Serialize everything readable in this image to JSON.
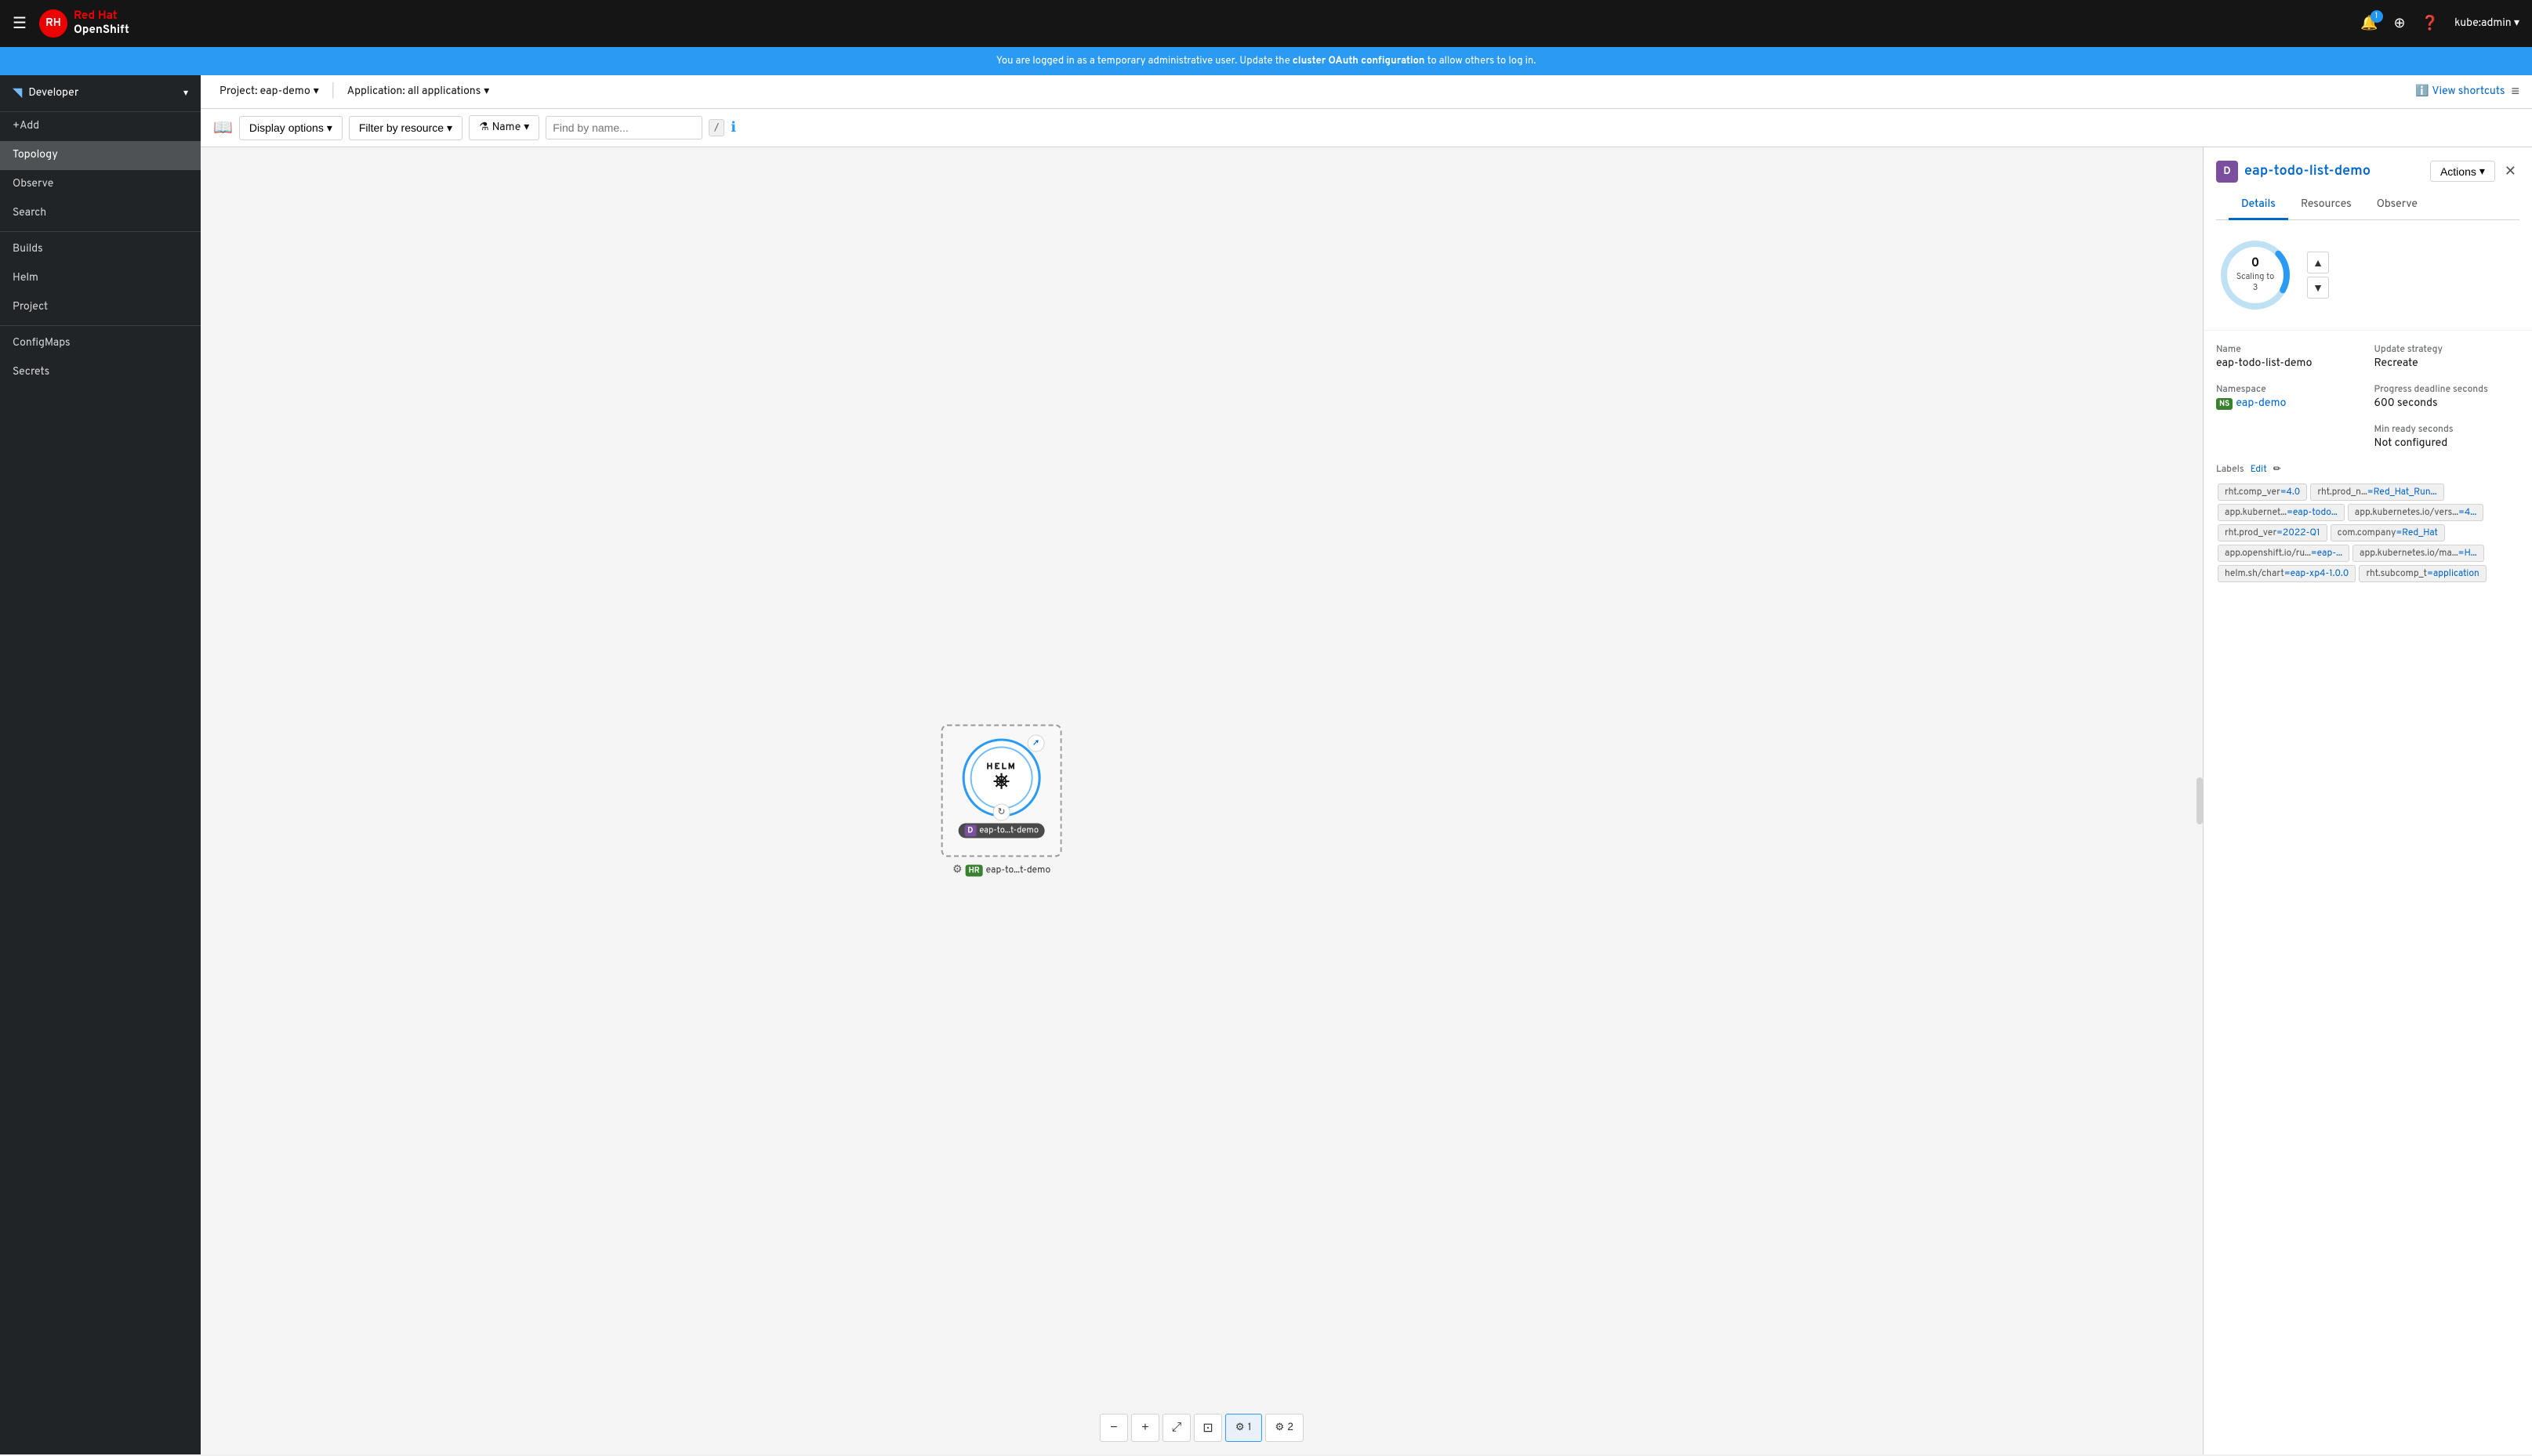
{
  "topnav": {
    "hamburger": "☰",
    "brand_red": "Red Hat",
    "brand_os": "OpenShift",
    "bell_icon": "🔔",
    "bell_count": "1",
    "plus_icon": "+",
    "help_icon": "?",
    "user": "kube:admin ▾"
  },
  "banner": {
    "text": "You are logged in as a temporary administrative user. Update the ",
    "link_text": "cluster OAuth configuration",
    "text2": " to allow others to log in."
  },
  "toolbar": {
    "project_label": "Project: eap-demo",
    "app_label": "Application: all applications",
    "view_shortcuts": "View shortcuts",
    "list_icon": "≡"
  },
  "filter_bar": {
    "display_options": "Display options",
    "filter_by_resource": "Filter by resource",
    "name_label": "Name",
    "find_placeholder": "Find by name...",
    "kbd": "/"
  },
  "sidebar": {
    "role_icon": "⬡",
    "role": "Developer",
    "items": [
      {
        "label": "+Add",
        "active": false
      },
      {
        "label": "Topology",
        "active": true
      },
      {
        "label": "Observe",
        "active": false
      },
      {
        "label": "Search",
        "active": false
      },
      {
        "label": "Builds",
        "active": false
      },
      {
        "label": "Helm",
        "active": false
      },
      {
        "label": "Project",
        "active": false
      },
      {
        "label": "ConfigMaps",
        "active": false
      },
      {
        "label": "Secrets",
        "active": false
      }
    ]
  },
  "topology": {
    "node": {
      "outer_stroke": "#2b9af3",
      "inner_stroke": "#73bcf7",
      "helm_text": "HELM",
      "helm_icon": "☸",
      "d_badge": "D",
      "label": "eap-to...t-demo",
      "sub_label": "eap-to...t-demo",
      "hr_badge": "HR"
    }
  },
  "zoom": {
    "zoom_in": "+",
    "zoom_out": "−",
    "fit": "⤢",
    "expand": "⊞",
    "tab1": "1",
    "tab2": "2"
  },
  "side_panel": {
    "d_icon": "D",
    "title": "eap-todo-list-demo",
    "close": "✕",
    "actions": "Actions",
    "tabs": [
      "Details",
      "Resources",
      "Observe"
    ],
    "active_tab": 0,
    "scaling": {
      "count": "0",
      "label": "Scaling to 3"
    },
    "details": {
      "name_label": "Name",
      "name_value": "eap-todo-list-demo",
      "update_strategy_label": "Update strategy",
      "update_strategy_value": "Recreate",
      "namespace_label": "Namespace",
      "namespace_ns": "NS",
      "namespace_value": "eap-demo",
      "progress_label": "Progress deadline seconds",
      "progress_value": "600 seconds",
      "min_ready_label": "Min ready seconds",
      "min_ready_value": "Not configured"
    },
    "labels": {
      "title": "Labels",
      "edit": "Edit",
      "items": [
        {
          "key": "rht.comp_ver",
          "val": "=4.0"
        },
        {
          "key": "rht.prod_n...",
          "val": "=Red_Hat_Run..."
        },
        {
          "key": "app.kubernet...",
          "val": "=eap-todo..."
        },
        {
          "key": "app.kubernetes.io/vers...",
          "val": "=4..."
        },
        {
          "key": "rht.prod_ver",
          "val": "=2022-Q1"
        },
        {
          "key": "com.company",
          "val": "=Red_Hat"
        },
        {
          "key": "app.openshift.io/ru...",
          "val": "=eap-..."
        },
        {
          "key": "app.kubernetes.io/ma...",
          "val": "=H..."
        },
        {
          "key": "helm.sh/chart",
          "val": "=eap-xp4-1.0.0"
        },
        {
          "key": "rht.subcomp_t",
          "val": "=application"
        }
      ]
    }
  },
  "colors": {
    "accent_blue": "#0066cc",
    "active_nav": "#4f5255",
    "brand_red": "#ee0000",
    "node_blue": "#2b9af3",
    "node_light_blue": "#73bcf7",
    "d_purple": "#7b4f9e",
    "ns_green": "#38812f",
    "hr_green": "#38812f"
  }
}
